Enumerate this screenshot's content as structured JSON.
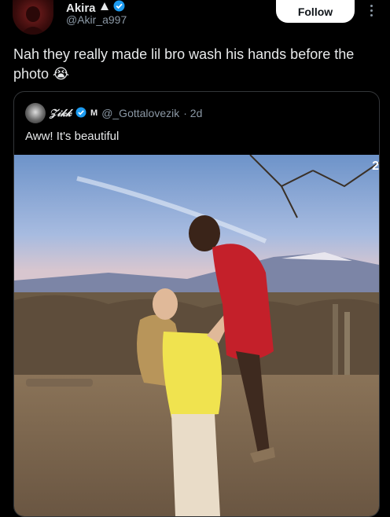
{
  "author": {
    "name": "Akira",
    "handle": "@Akir_a997",
    "follow_label": "Follow"
  },
  "tweet": {
    "text": "Nah they really made lil bro wash his hands before the photo 😭"
  },
  "quoted": {
    "name": "𝒵𝒾𝓀𝓀",
    "badge_m": "M",
    "handle": "@_Gottalovezik",
    "age": "· 2d",
    "text": "Aww! It's beautiful",
    "photo_count": "2"
  },
  "colors": {
    "background": "#000000",
    "text": "#e7e9ea",
    "secondary": "#8b98a5",
    "verified": "#1d9bf0",
    "follow_bg": "#ffffff"
  },
  "icons": {
    "verified": "verified-badge-icon",
    "more": "more-options-icon"
  }
}
